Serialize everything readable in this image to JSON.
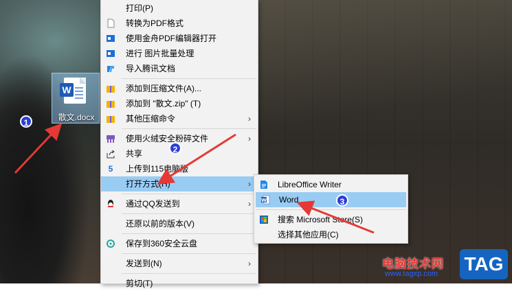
{
  "desktop": {
    "file_label": "散文.docx",
    "app_glyph": "W"
  },
  "main_menu": {
    "items": [
      {
        "label": "打印(P)",
        "icon": "none",
        "submenu": false
      },
      {
        "label": "转换为PDF格式",
        "icon": "blank-page-icon",
        "submenu": false
      },
      {
        "label": "使用金舟PDF编辑器打开",
        "icon": "pdf-editor-icon",
        "submenu": false
      },
      {
        "label": "进行 图片批量处理",
        "icon": "image-batch-icon",
        "submenu": false
      },
      {
        "label": "导入腾讯文档",
        "icon": "tencent-docs-icon",
        "submenu": false
      },
      {
        "label": "添加到压缩文件(A)...",
        "icon": "archive-icon",
        "submenu": false
      },
      {
        "label": "添加到 \"散文.zip\" (T)",
        "icon": "archive-icon",
        "submenu": false
      },
      {
        "label": "其他压缩命令",
        "icon": "archive-icon",
        "submenu": true
      },
      {
        "label": "使用火绒安全粉碎文件",
        "icon": "shredder-icon",
        "submenu": true
      },
      {
        "label": "共享",
        "icon": "share-icon",
        "submenu": false
      },
      {
        "label": "上传到115电脑版",
        "icon": "upload-115-icon",
        "submenu": false
      },
      {
        "label": "打开方式(H)",
        "icon": "none",
        "submenu": true,
        "highlighted": true
      },
      {
        "label": "通过QQ发送到",
        "icon": "qq-icon",
        "submenu": true
      },
      {
        "label": "还原以前的版本(V)",
        "icon": "none",
        "submenu": false
      },
      {
        "label": "保存到360安全云盘",
        "icon": "cloud-360-icon",
        "submenu": false
      },
      {
        "label": "发送到(N)",
        "icon": "none",
        "submenu": true
      },
      {
        "label": "剪切(T)",
        "icon": "none",
        "submenu": false
      }
    ]
  },
  "open_with_menu": {
    "items": [
      {
        "label": "LibreOffice Writer",
        "icon": "libreoffice-writer-icon"
      },
      {
        "label": "Word",
        "icon": "word-icon",
        "highlighted": true
      },
      {
        "label": "搜索 Microsoft Store(S)",
        "icon": "store-icon"
      },
      {
        "label": "选择其他应用(C)",
        "icon": "none"
      }
    ]
  },
  "annotations": {
    "step1": "1",
    "step2": "2",
    "step3": "3",
    "arrow_color": "#e53935",
    "badge_color": "#2b3fd6"
  },
  "watermark": {
    "text": "电脑技术网",
    "url": "www.tagxp.com",
    "logo": "TAG"
  },
  "colors": {
    "highlight": "#99ccf3",
    "menu_bg": "#f2f2f2"
  }
}
